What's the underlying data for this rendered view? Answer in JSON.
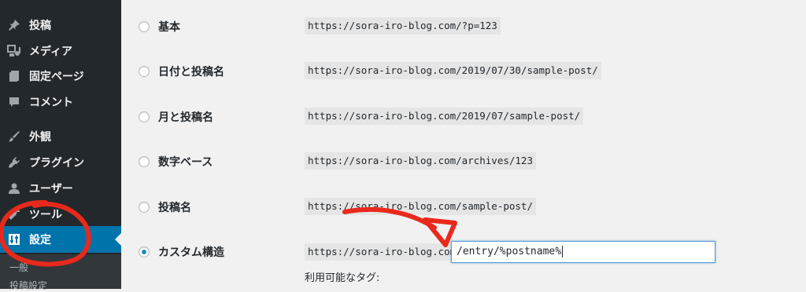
{
  "sidebar": {
    "items": [
      {
        "label": "投稿",
        "icon": "pushpin-icon"
      },
      {
        "label": "メディア",
        "icon": "media-icon"
      },
      {
        "label": "固定ページ",
        "icon": "page-icon"
      },
      {
        "label": "コメント",
        "icon": "comment-icon"
      },
      {
        "label": "外観",
        "icon": "brush-icon"
      },
      {
        "label": "プラグイン",
        "icon": "plugin-icon"
      },
      {
        "label": "ユーザー",
        "icon": "user-icon"
      },
      {
        "label": "ツール",
        "icon": "wrench-icon"
      },
      {
        "label": "設定",
        "icon": "settings-icon"
      }
    ],
    "active_item": "設定",
    "submenu": [
      {
        "label": "一般"
      },
      {
        "label": "投稿設定"
      }
    ]
  },
  "permalink": {
    "options": [
      {
        "label": "基本",
        "example": "https://sora-iro-blog.com/?p=123",
        "selected": false
      },
      {
        "label": "日付と投稿名",
        "example": "https://sora-iro-blog.com/2019/07/30/sample-post/",
        "selected": false
      },
      {
        "label": "月と投稿名",
        "example": "https://sora-iro-blog.com/2019/07/sample-post/",
        "selected": false
      },
      {
        "label": "数字ベース",
        "example": "https://sora-iro-blog.com/archives/123",
        "selected": false
      },
      {
        "label": "投稿名",
        "example": "https://sora-iro-blog.com/sample-post/",
        "selected": false
      },
      {
        "label": "カスタム構造",
        "example": "https://sora-iro-blog.com",
        "selected": true
      }
    ],
    "custom_structure_value": "/entry/%postname%",
    "available_tags_label": "利用可能なタグ:"
  },
  "colors": {
    "sidebar_bg": "#23282d",
    "active_bg": "#0073aa",
    "annotation_red": "#e8291c"
  }
}
